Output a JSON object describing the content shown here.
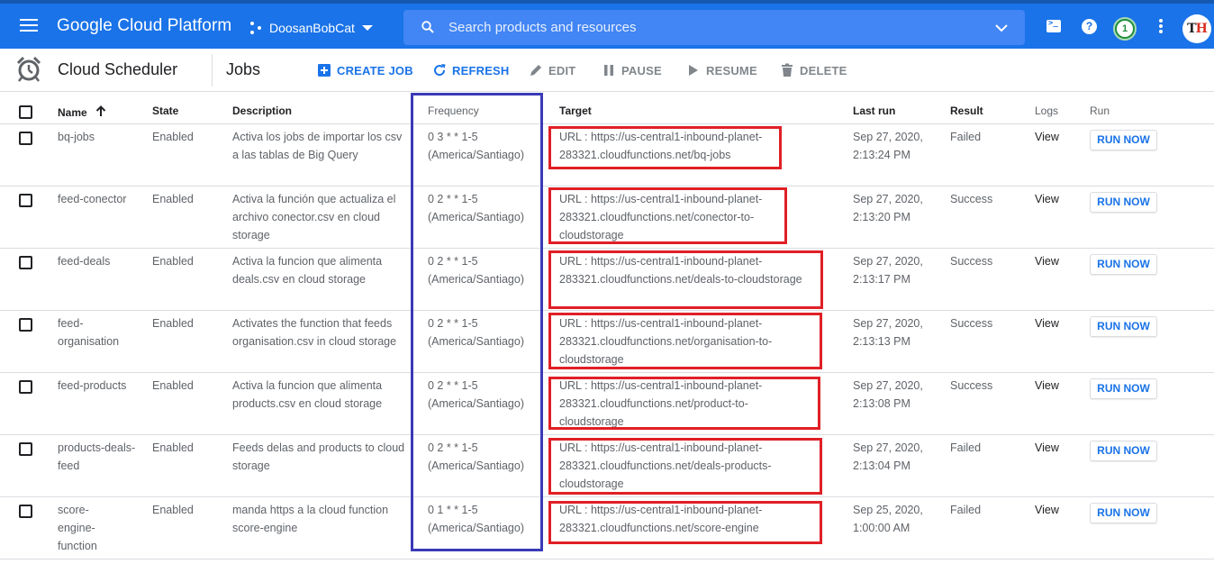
{
  "topbar": {
    "brand": "Google Cloud Platform",
    "project": "DoosanBobCat",
    "search_placeholder": "Search products and resources",
    "notification_count": "1",
    "avatar_left": "T",
    "avatar_right": "H",
    "colors": {
      "bar": "#1a73e8",
      "search": "#4285f4"
    }
  },
  "toolbar": {
    "title": "Cloud Scheduler",
    "subtitle": "Jobs",
    "create_job": "CREATE JOB",
    "refresh": "REFRESH",
    "edit": "EDIT",
    "pause": "PAUSE",
    "resume": "RESUME",
    "delete": "DELETE"
  },
  "table": {
    "headers": {
      "name": "Name",
      "state": "State",
      "description": "Description",
      "frequency": "Frequency",
      "target": "Target",
      "last_run": "Last run",
      "result": "Result",
      "logs": "Logs",
      "run": "Run"
    },
    "rows": [
      {
        "name": "bq-jobs",
        "state": "Enabled",
        "description": "Activa los jobs de importar los csv a las tablas de Big Query",
        "frequency": "0 3 * * 1-5 (America/Santiago)",
        "target": "URL : https://us-central1-inbound-planet-283321.cloudfunctions.net/bq-jobs",
        "last_run": "Sep 27, 2020, 2:13:24 PM",
        "result": "Failed",
        "logs": "View",
        "run": "RUN NOW"
      },
      {
        "name": "feed-conector",
        "state": "Enabled",
        "description": "Activa la función que actualiza el archivo conector.csv en cloud storage",
        "frequency": "0 2 * * 1-5 (America/Santiago)",
        "target": "URL : https://us-central1-inbound-planet-283321.cloudfunctions.net/conector-to-cloudstorage",
        "last_run": "Sep 27, 2020, 2:13:20 PM",
        "result": "Success",
        "logs": "View",
        "run": "RUN NOW"
      },
      {
        "name": "feed-deals",
        "state": "Enabled",
        "description": "Activa la funcion que alimenta deals.csv en cloud storage",
        "frequency": "0 2 * * 1-5 (America/Santiago)",
        "target": "URL : https://us-central1-inbound-planet-283321.cloudfunctions.net/deals-to-cloudstorage",
        "last_run": "Sep 27, 2020, 2:13:17 PM",
        "result": "Success",
        "logs": "View",
        "run": "RUN NOW"
      },
      {
        "name": "feed-organisation",
        "state": "Enabled",
        "description": "Activates the function that feeds organisation.csv in cloud storage",
        "frequency": "0 2 * * 1-5 (America/Santiago)",
        "target": "URL : https://us-central1-inbound-planet-283321.cloudfunctions.net/organisation-to-cloudstorage",
        "last_run": "Sep 27, 2020, 2:13:13 PM",
        "result": "Success",
        "logs": "View",
        "run": "RUN NOW"
      },
      {
        "name": "feed-products",
        "state": "Enabled",
        "description": "Activa la funcion que alimenta products.csv en cloud storage",
        "frequency": "0 2 * * 1-5 (America/Santiago)",
        "target": "URL : https://us-central1-inbound-planet-283321.cloudfunctions.net/product-to-cloudstorage",
        "last_run": "Sep 27, 2020, 2:13:08 PM",
        "result": "Success",
        "logs": "View",
        "run": "RUN NOW"
      },
      {
        "name": "products-deals-feed",
        "state": "Enabled",
        "description": "Feeds delas and products to cloud storage",
        "frequency": "0 2 * * 1-5 (America/Santiago)",
        "target": "URL : https://us-central1-inbound-planet-283321.cloudfunctions.net/deals-products-cloudstorage",
        "last_run": "Sep 27, 2020, 2:13:04 PM",
        "result": "Failed",
        "logs": "View",
        "run": "RUN NOW"
      },
      {
        "name": "score-engine-function",
        "state": "Enabled",
        "description": "manda https a la cloud function score-engine",
        "frequency": "0 1 * * 1-5 (America/Santiago)",
        "target": "URL : https://us-central1-inbound-planet-283321.cloudfunctions.net/score-engine",
        "last_run": "Sep 25, 2020, 1:00:00 AM",
        "result": "Failed",
        "logs": "View",
        "run": "RUN NOW"
      }
    ]
  },
  "annotations": {
    "frequency_highlight_color": "#3a3ab8",
    "target_highlight_color": "#e01f26"
  }
}
